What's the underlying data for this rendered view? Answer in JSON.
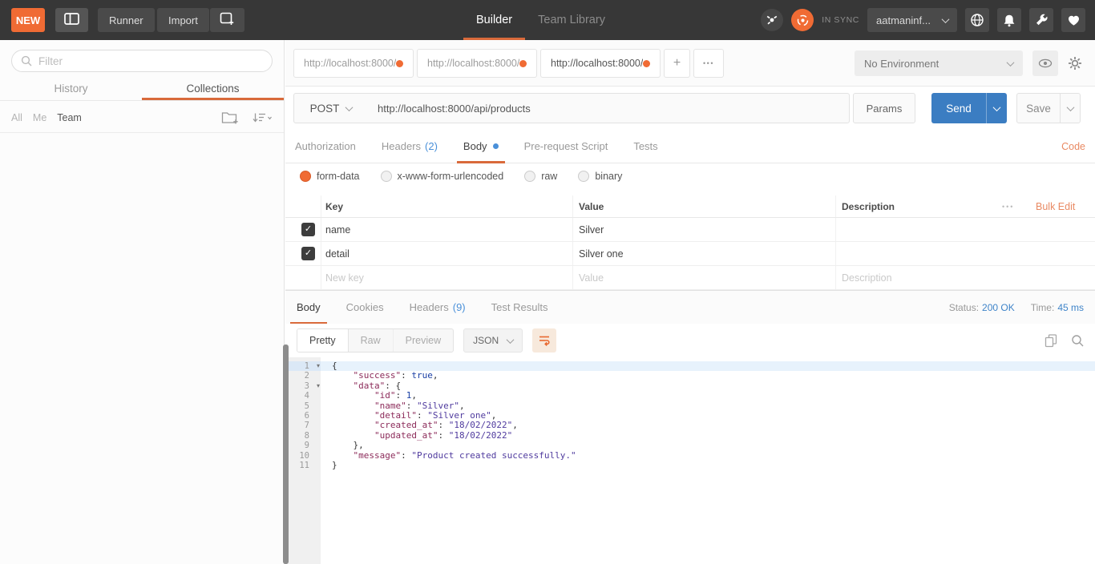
{
  "colors": {
    "accent_orange": "#f06b34",
    "link_orange": "#e98a63",
    "info_blue": "#4a90d9",
    "status_blue": "#3f84c9",
    "send_blue": "#3b7dc2"
  },
  "header": {
    "new_label": "NEW",
    "runner_label": "Runner",
    "import_label": "Import",
    "nav_tabs": [
      {
        "label": "Builder",
        "active": true
      },
      {
        "label": "Team Library",
        "active": false
      }
    ],
    "sync_label": "IN SYNC",
    "account_label": "aatmaninf..."
  },
  "sidebar": {
    "filter_placeholder": "Filter",
    "tabs": [
      {
        "label": "History",
        "active": false
      },
      {
        "label": "Collections",
        "active": true
      }
    ],
    "scopes": [
      {
        "label": "All",
        "active": false
      },
      {
        "label": "Me",
        "active": false
      },
      {
        "label": "Team",
        "active": true
      }
    ]
  },
  "tabstrip": {
    "tabs": [
      {
        "title": "http://localhost:8000/",
        "active": false
      },
      {
        "title": "http://localhost:8000/",
        "active": false
      },
      {
        "title": "http://localhost:8000/",
        "active": true
      }
    ],
    "add_label": "+",
    "more_label": "•••",
    "environment": {
      "selected": "No Environment"
    }
  },
  "request": {
    "method": "POST",
    "url": "http://localhost:8000/api/products",
    "params_label": "Params",
    "send_label": "Send",
    "save_label": "Save",
    "editor_tabs": [
      {
        "label": "Authorization"
      },
      {
        "label": "Headers",
        "count": "(2)"
      },
      {
        "label": "Body",
        "active": true,
        "dot": true
      },
      {
        "label": "Pre-request Script"
      },
      {
        "label": "Tests"
      }
    ],
    "code_link": "Code",
    "body_modes": [
      {
        "label": "form-data",
        "selected": true
      },
      {
        "label": "x-www-form-urlencoded",
        "selected": false
      },
      {
        "label": "raw",
        "selected": false
      },
      {
        "label": "binary",
        "selected": false
      }
    ],
    "table": {
      "columns": [
        "Key",
        "Value",
        "Description"
      ],
      "more_label": "•••",
      "bulk_edit_label": "Bulk Edit",
      "rows": [
        {
          "checked": true,
          "key": "name",
          "value": "Silver",
          "description": ""
        },
        {
          "checked": true,
          "key": "detail",
          "value": "Silver one",
          "description": ""
        }
      ],
      "new_row_placeholders": {
        "key": "New key",
        "value": "Value",
        "description": "Description"
      }
    }
  },
  "response": {
    "tabs": [
      {
        "label": "Body",
        "active": true
      },
      {
        "label": "Cookies"
      },
      {
        "label": "Headers",
        "count": "(9)"
      },
      {
        "label": "Test Results"
      }
    ],
    "status_label": "Status:",
    "status_value": "200 OK",
    "time_label": "Time:",
    "time_value": "45 ms",
    "view_modes": [
      {
        "label": "Pretty",
        "active": true
      },
      {
        "label": "Raw"
      },
      {
        "label": "Preview"
      }
    ],
    "format_selected": "JSON",
    "code": {
      "lines": [
        {
          "n": 1,
          "fold": true,
          "hl": true,
          "tokens": [
            [
              "p",
              "{"
            ]
          ]
        },
        {
          "n": 2,
          "tokens": [
            [
              "p",
              "    "
            ],
            [
              "k",
              "\"success\""
            ],
            [
              "p",
              ": "
            ],
            [
              "v",
              "true"
            ],
            [
              "p",
              ","
            ]
          ]
        },
        {
          "n": 3,
          "fold": true,
          "tokens": [
            [
              "p",
              "    "
            ],
            [
              "k",
              "\"data\""
            ],
            [
              "p",
              ": {"
            ]
          ]
        },
        {
          "n": 4,
          "tokens": [
            [
              "p",
              "        "
            ],
            [
              "k",
              "\"id\""
            ],
            [
              "p",
              ": "
            ],
            [
              "v",
              "1"
            ],
            [
              "p",
              ","
            ]
          ]
        },
        {
          "n": 5,
          "tokens": [
            [
              "p",
              "        "
            ],
            [
              "k",
              "\"name\""
            ],
            [
              "p",
              ": "
            ],
            [
              "s",
              "\"Silver\""
            ],
            [
              "p",
              ","
            ]
          ]
        },
        {
          "n": 6,
          "tokens": [
            [
              "p",
              "        "
            ],
            [
              "k",
              "\"detail\""
            ],
            [
              "p",
              ": "
            ],
            [
              "s",
              "\"Silver one\""
            ],
            [
              "p",
              ","
            ]
          ]
        },
        {
          "n": 7,
          "tokens": [
            [
              "p",
              "        "
            ],
            [
              "k",
              "\"created_at\""
            ],
            [
              "p",
              ": "
            ],
            [
              "s",
              "\"18/02/2022\""
            ],
            [
              "p",
              ","
            ]
          ]
        },
        {
          "n": 8,
          "tokens": [
            [
              "p",
              "        "
            ],
            [
              "k",
              "\"updated_at\""
            ],
            [
              "p",
              ": "
            ],
            [
              "s",
              "\"18/02/2022\""
            ]
          ]
        },
        {
          "n": 9,
          "tokens": [
            [
              "p",
              "    },"
            ]
          ]
        },
        {
          "n": 10,
          "tokens": [
            [
              "p",
              "    "
            ],
            [
              "k",
              "\"message\""
            ],
            [
              "p",
              ": "
            ],
            [
              "s",
              "\"Product created successfully.\""
            ]
          ]
        },
        {
          "n": 11,
          "tokens": [
            [
              "p",
              "}"
            ]
          ]
        }
      ]
    }
  }
}
